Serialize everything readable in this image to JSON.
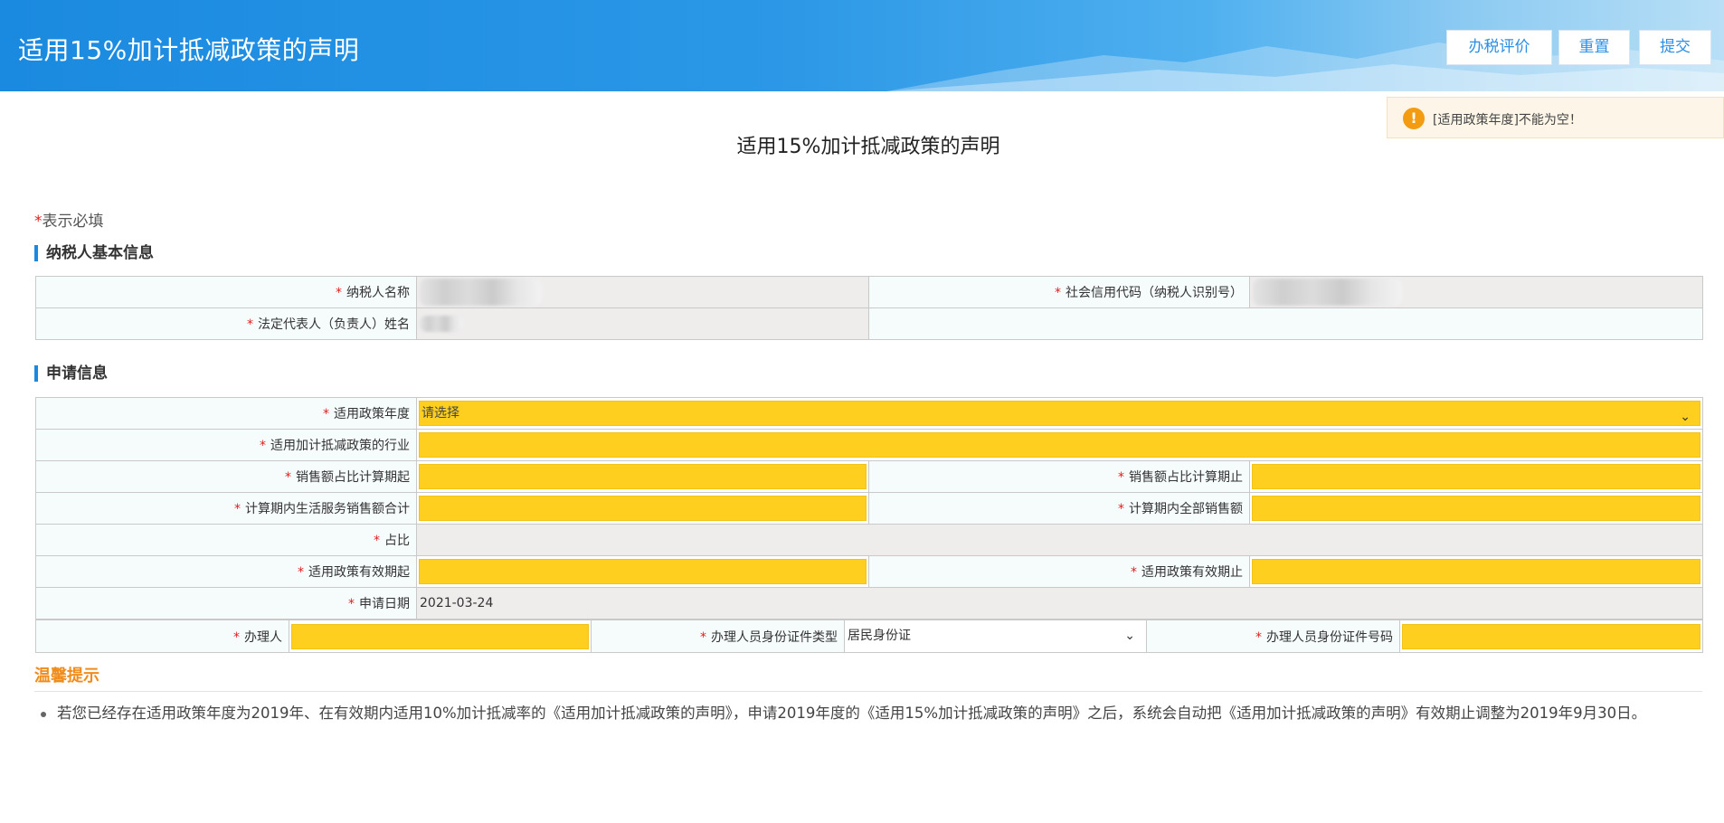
{
  "header": {
    "title": "适用15%加计抵减政策的声明",
    "buttons": {
      "evaluate": "办税评价",
      "reset": "重置",
      "submit": "提交"
    }
  },
  "toast": {
    "icon": "exclamation-icon",
    "icon_glyph": "!",
    "message": "[适用政策年度]不能为空！"
  },
  "doc_title": "适用15%加计抵减政策的声明",
  "required_note": {
    "star": "*",
    "text": "表示必填"
  },
  "section_basic": {
    "title": "纳税人基本信息",
    "labels": {
      "taxpayer_name": "纳税人名称",
      "credit_code": "社会信用代码（纳税人识别号）",
      "legal_rep": "法定代表人（负责人）姓名"
    }
  },
  "section_apply": {
    "title": "申请信息",
    "labels": {
      "policy_year": "适用政策年度",
      "industry": "适用加计抵减政策的行业",
      "sales_start": "销售额占比计算期起",
      "sales_end": "销售额占比计算期止",
      "life_service_sales": "计算期内生活服务销售额合计",
      "total_sales": "计算期内全部销售额",
      "ratio": "占比",
      "valid_start": "适用政策有效期起",
      "valid_end": "适用政策有效期止",
      "apply_date": "申请日期",
      "handler": "办理人",
      "id_type": "办理人员身份证件类型",
      "id_number": "办理人员身份证件号码"
    },
    "values": {
      "policy_year": "请选择",
      "apply_date": "2021-03-24",
      "id_type": "居民身份证"
    }
  },
  "tips": {
    "title": "温馨提示",
    "text": "若您已经存在适用政策年度为2019年、在有效期内适用10%加计抵减率的《适用加计抵减政策的声明》，申请2019年度的《适用15%加计抵减政策的声明》之后，系统会自动把《适用加计抵减政策的声明》有效期止调整为2019年9月30日。"
  },
  "colors": {
    "header_blue": "#1a8ae0",
    "required_star": "#e02020",
    "input_yellow": "#fecf1e",
    "tip_orange": "#f08c1c",
    "warn": "#f39c12"
  }
}
